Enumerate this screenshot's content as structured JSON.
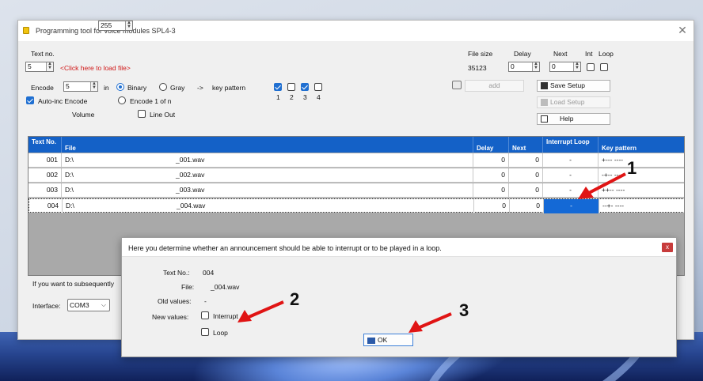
{
  "app_title": "Programming tool for voice modules SPL4-3",
  "text_no_label": "Text no.",
  "text_no_value": "5",
  "load_file_link": "<Click here to load file>",
  "file_size_label": "File size",
  "file_size_value": "35123",
  "delay_label": "Delay",
  "delay_value": "0",
  "next_label": "Next",
  "next_value": "0",
  "int_label": "Int",
  "loop_label": "Loop",
  "encode_label": "Encode",
  "encode_value": "5",
  "in_label": "in",
  "binary_label": "Binary",
  "gray_label": "Gray",
  "arrow_label": "->",
  "key_pattern_label": "key pattern",
  "key_checkbox_numbers": [
    "1",
    "2",
    "3",
    "4"
  ],
  "auto_inc_label": "Auto-inc Encode",
  "encode_1_of_n_label": "Encode 1 of n",
  "volume_label": "Volume",
  "volume_value": "255",
  "line_out_label": "Line Out",
  "add_label": "add",
  "save_setup_label": "Save Setup",
  "load_setup_label": "Load Setup",
  "help_label": "Help",
  "grid": {
    "headers": {
      "text_no": "Text No.",
      "file": "File",
      "delay": "Delay",
      "next": "Next",
      "interrupt_loop": "Interrupt Loop",
      "key_pattern": "Key pattern"
    },
    "rows": [
      {
        "no": "001",
        "path": "D:\\",
        "file": "_001.wav",
        "delay": "0",
        "next": "0",
        "il": "-",
        "key": "+---  ----"
      },
      {
        "no": "002",
        "path": "D:\\",
        "file": "_002.wav",
        "delay": "0",
        "next": "0",
        "il": "-",
        "key": "-+--  ----"
      },
      {
        "no": "003",
        "path": "D:\\",
        "file": "_003.wav",
        "delay": "0",
        "next": "0",
        "il": "-",
        "key": "++--  ----"
      },
      {
        "no": "004",
        "path": "D:\\",
        "file": "_004.wav",
        "delay": "0",
        "next": "0",
        "il": "-",
        "key": "--+-  ----"
      }
    ]
  },
  "subsequently_text": "If you want to subsequently",
  "interface_label": "Interface:",
  "interface_value": "COM3",
  "dialog": {
    "title": "Here you determine whether an announcement should be able to interrupt or to be played in a loop.",
    "close": "x",
    "text_no_label": "Text No.:",
    "text_no_value": "004",
    "file_label": "File:",
    "file_value": "_004.wav",
    "old_values_label": "Old values:",
    "old_values_value": "-",
    "new_values_label": "New values:",
    "interrupt_label": "Interrupt",
    "loop_label": "Loop",
    "ok_label": "OK"
  },
  "annotations": [
    "1",
    "2",
    "3"
  ],
  "colors": {
    "accent": "#1461c7",
    "link": "#d01818",
    "arrow": "#e01414"
  }
}
